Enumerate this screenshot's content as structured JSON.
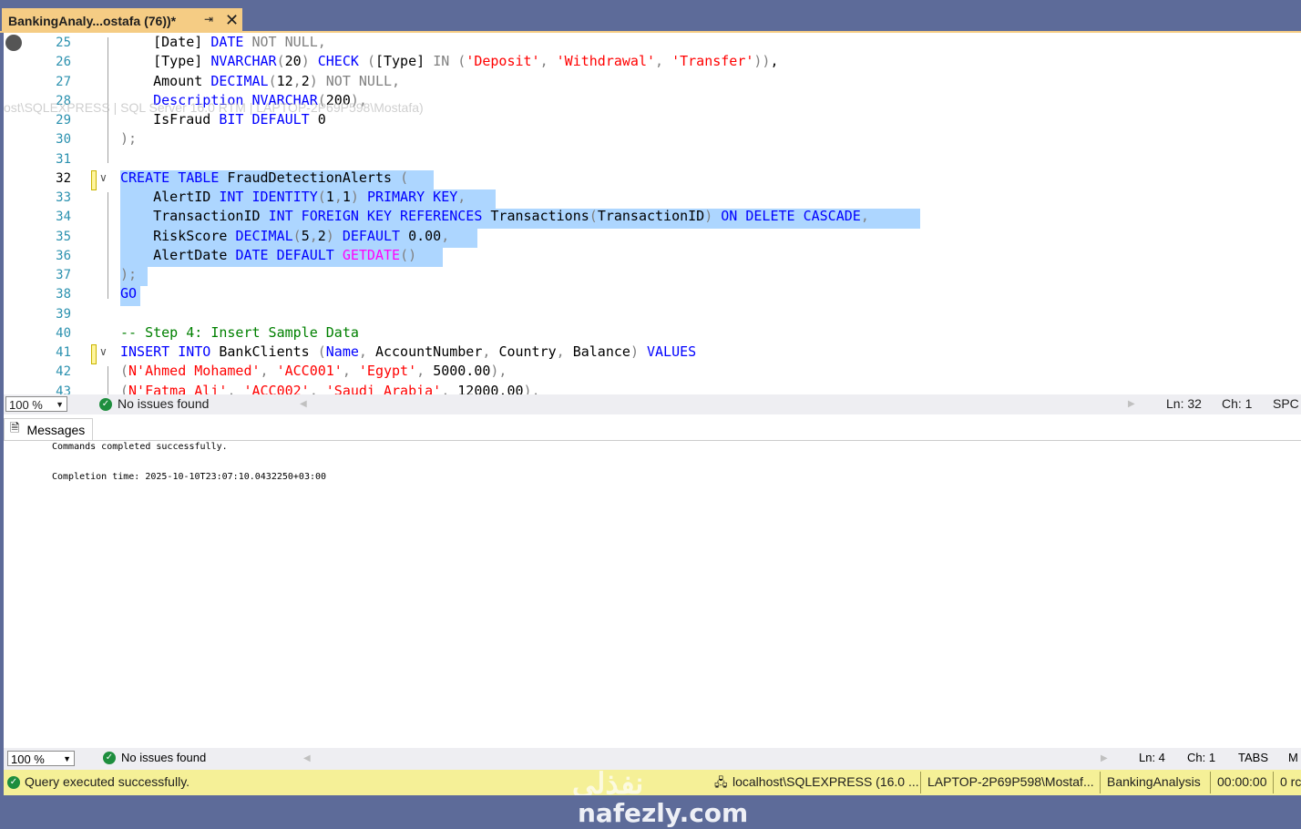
{
  "tab": {
    "title": "BankingAnaly...ostafa (76))*",
    "pin_icon": "pin-icon",
    "close_icon": "close-icon"
  },
  "editor": {
    "watermark": "ost\\SQLEXPRESS | SQL Server 16.0 RTM | LAPTOP-2P69P598\\Mostafa)",
    "lines": [
      {
        "num": "25",
        "segs": [
          [
            "",
            "    [Date] "
          ],
          [
            "kw",
            "DATE "
          ],
          [
            "gr",
            "NOT NULL,"
          ]
        ]
      },
      {
        "num": "26",
        "segs": [
          [
            "",
            "    [Type] "
          ],
          [
            "kw",
            "NVARCHAR"
          ],
          [
            "gr",
            "("
          ],
          [
            "",
            "20"
          ],
          [
            "gr",
            ") "
          ],
          [
            "kw",
            "CHECK "
          ],
          [
            "gr",
            "("
          ],
          [
            "",
            "[Type] "
          ],
          [
            "gr",
            "IN ("
          ],
          [
            "st",
            "'Deposit'"
          ],
          [
            "gr",
            ", "
          ],
          [
            "st",
            "'Withdrawal'"
          ],
          [
            "gr",
            ", "
          ],
          [
            "st",
            "'Transfer'"
          ],
          [
            "gr",
            "))"
          ],
          [
            "",
            ","
          ]
        ]
      },
      {
        "num": "27",
        "segs": [
          [
            "",
            "    Amount "
          ],
          [
            "kw",
            "DECIMAL"
          ],
          [
            "gr",
            "("
          ],
          [
            "",
            "12"
          ],
          [
            "gr",
            ","
          ],
          [
            "",
            "2"
          ],
          [
            "gr",
            ") NOT NULL,"
          ]
        ]
      },
      {
        "num": "28",
        "segs": [
          [
            "",
            "    "
          ],
          [
            "kw",
            "Description NVARCHAR"
          ],
          [
            "gr",
            "("
          ],
          [
            "",
            "200"
          ],
          [
            "gr",
            "),"
          ]
        ]
      },
      {
        "num": "29",
        "segs": [
          [
            "",
            "    IsFraud "
          ],
          [
            "kw",
            "BIT DEFAULT "
          ],
          [
            "",
            "0"
          ]
        ]
      },
      {
        "num": "30",
        "segs": [
          [
            "gr",
            ");"
          ]
        ]
      },
      {
        "num": "31",
        "segs": []
      },
      {
        "num": "32",
        "segs": [
          [
            "kw",
            "CREATE TABLE "
          ],
          [
            "",
            "FraudDetectionAlerts "
          ],
          [
            "gr",
            "("
          ]
        ]
      },
      {
        "num": "33",
        "segs": [
          [
            "",
            "    AlertID "
          ],
          [
            "kw",
            "INT IDENTITY"
          ],
          [
            "gr",
            "("
          ],
          [
            "",
            "1"
          ],
          [
            "gr",
            ","
          ],
          [
            "",
            "1"
          ],
          [
            "gr",
            ") "
          ],
          [
            "kw",
            "PRIMARY KEY"
          ],
          [
            "gr",
            ","
          ]
        ]
      },
      {
        "num": "34",
        "segs": [
          [
            "",
            "    TransactionID "
          ],
          [
            "kw",
            "INT FOREIGN KEY REFERENCES "
          ],
          [
            "",
            "Transactions"
          ],
          [
            "gr",
            "("
          ],
          [
            "",
            "TransactionID"
          ],
          [
            "gr",
            ") "
          ],
          [
            "kw",
            "ON DELETE CASCADE"
          ],
          [
            "gr",
            ","
          ]
        ]
      },
      {
        "num": "35",
        "segs": [
          [
            "",
            "    RiskScore "
          ],
          [
            "kw",
            "DECIMAL"
          ],
          [
            "gr",
            "("
          ],
          [
            "",
            "5"
          ],
          [
            "gr",
            ","
          ],
          [
            "",
            "2"
          ],
          [
            "gr",
            ") "
          ],
          [
            "kw",
            "DEFAULT "
          ],
          [
            "",
            "0.00"
          ],
          [
            "gr",
            ","
          ]
        ]
      },
      {
        "num": "36",
        "segs": [
          [
            "",
            "    AlertDate "
          ],
          [
            "kw",
            "DATE DEFAULT "
          ],
          [
            "mg",
            "GETDATE"
          ],
          [
            "gr",
            "()"
          ]
        ]
      },
      {
        "num": "37",
        "segs": [
          [
            "gr",
            ");"
          ]
        ]
      },
      {
        "num": "38",
        "segs": [
          [
            "kw",
            "GO"
          ]
        ]
      },
      {
        "num": "39",
        "segs": []
      },
      {
        "num": "40",
        "segs": [
          [
            "cm",
            "-- Step 4: Insert Sample Data"
          ]
        ]
      },
      {
        "num": "41",
        "segs": [
          [
            "kw",
            "INSERT INTO "
          ],
          [
            "",
            "BankClients "
          ],
          [
            "gr",
            "("
          ],
          [
            "kw",
            "Name"
          ],
          [
            "gr",
            ", "
          ],
          [
            "",
            "AccountNumber"
          ],
          [
            "gr",
            ", "
          ],
          [
            "",
            "Country"
          ],
          [
            "gr",
            ", "
          ],
          [
            "",
            "Balance"
          ],
          [
            "gr",
            ") "
          ],
          [
            "kw",
            "VALUES"
          ]
        ]
      },
      {
        "num": "42",
        "segs": [
          [
            "gr",
            "("
          ],
          [
            "st",
            "N'Ahmed Mohamed'"
          ],
          [
            "gr",
            ", "
          ],
          [
            "st",
            "'ACC001'"
          ],
          [
            "gr",
            ", "
          ],
          [
            "st",
            "'Egypt'"
          ],
          [
            "gr",
            ", "
          ],
          [
            "",
            "5000.00"
          ],
          [
            "gr",
            "),"
          ]
        ]
      },
      {
        "num": "43",
        "segs": [
          [
            "gr",
            "("
          ],
          [
            "st",
            "N'Fatma Ali'"
          ],
          [
            "gr",
            ", "
          ],
          [
            "st",
            "'ACC002'"
          ],
          [
            "gr",
            ", "
          ],
          [
            "st",
            "'Saudi Arabia'"
          ],
          [
            "gr",
            ", "
          ],
          [
            "",
            "12000.00"
          ],
          [
            "gr",
            "),"
          ]
        ]
      }
    ]
  },
  "editor_status": {
    "zoom": "100 %",
    "issues": "No issues found",
    "ln": "Ln: 32",
    "ch": "Ch: 1",
    "mode": "SPC"
  },
  "results": {
    "tab_label": "Messages",
    "messages": [
      "Commands completed successfully.",
      "",
      "Completion time: 2025-10-10T23:07:10.0432250+03:00"
    ]
  },
  "results_status": {
    "zoom": "100 %",
    "issues": "No issues found",
    "ln": "Ln: 4",
    "ch": "Ch: 1",
    "mode": "TABS",
    "extra": "M"
  },
  "query_status": {
    "message": "Query executed successfully.",
    "server": "localhost\\SQLEXPRESS (16.0 ...",
    "user": "LAPTOP-2P69P598\\Mostaf...",
    "database": "BankingAnalysis",
    "elapsed": "00:00:00",
    "rows": "0 rc"
  },
  "brand": {
    "latin": "nafezly.com",
    "arabic": "نفذلي"
  },
  "colors": {
    "keyword": "#0000ff",
    "string": "#ff0000",
    "comment": "#008000",
    "function": "#ff00ff",
    "selection": "#add6ff",
    "tab_active": "#f5cc84",
    "status_bar": "#f5f097"
  }
}
